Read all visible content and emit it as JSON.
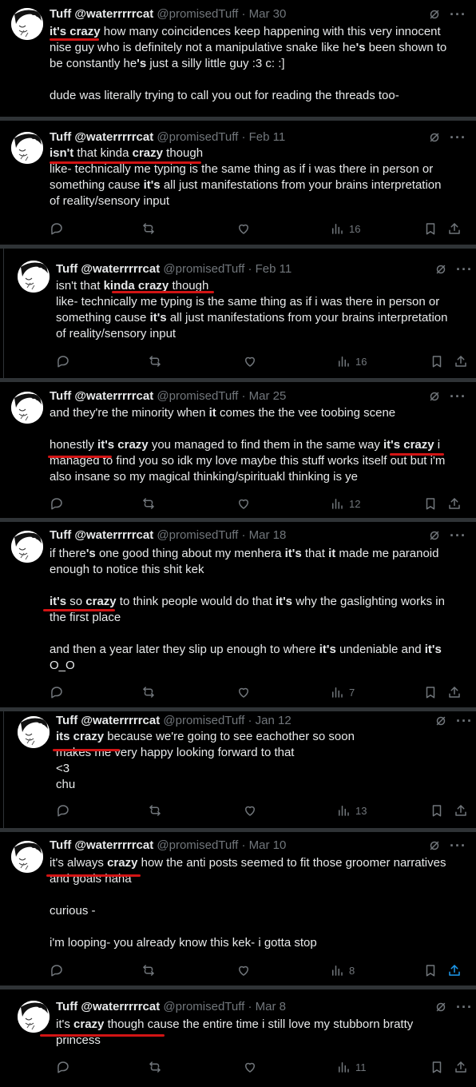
{
  "author": {
    "name": "Tuff",
    "handle_combo": "@waterrrrrcat",
    "at": "@promisedTuff"
  },
  "tweets": [
    {
      "date": "Mar 30",
      "lines": [
        [
          {
            "b": "it's crazy"
          },
          {
            "t": " how many coincidences keep happening with this very innocent"
          }
        ],
        [
          {
            "t": "nise guy who is definitely not a manipulative snake like he"
          },
          {
            "b": "'s"
          },
          {
            "t": " been shown to"
          }
        ],
        [
          {
            "t": "be constantly he"
          },
          {
            "b": "'s"
          },
          {
            "t": " just a silly little guy :3 c: :]"
          }
        ],
        [
          {
            "t": ""
          }
        ],
        [
          {
            "t": "dude was literally trying to call you out for reading the threads too-"
          }
        ]
      ],
      "views": ""
    },
    {
      "date": "Feb 11",
      "lines": [
        [
          {
            "b": "isn't"
          },
          {
            "t": " that kinda "
          },
          {
            "b": "crazy"
          },
          {
            "t": " though"
          }
        ],
        [
          {
            "t": "like- technically me typing is the same thing as if i was there in person or"
          }
        ],
        [
          {
            "t": "something cause "
          },
          {
            "b": "it's"
          },
          {
            "t": " all just manifestations from your brains interpretation"
          }
        ],
        [
          {
            "t": "of reality/sensory input"
          }
        ]
      ],
      "views": "16"
    },
    {
      "date": "Feb 11",
      "lines": [
        [
          {
            "t": "isn't that "
          },
          {
            "b": "kinda crazy"
          },
          {
            "t": " though"
          }
        ],
        [
          {
            "t": "like- technically me typing is the same thing as if i was there in person or"
          }
        ],
        [
          {
            "t": "something cause "
          },
          {
            "b": "it's"
          },
          {
            "t": " all just manifestations from your brains interpretation"
          }
        ],
        [
          {
            "t": "of reality/sensory input"
          }
        ]
      ],
      "views": "16"
    },
    {
      "date": "Mar 25",
      "lines": [
        [
          {
            "t": "and they're the minority when "
          },
          {
            "b": "it"
          },
          {
            "t": " comes the the vee toobing scene"
          }
        ],
        [
          {
            "t": ""
          }
        ],
        [
          {
            "t": "honestly "
          },
          {
            "b": "it's crazy"
          },
          {
            "t": " you managed to find them in the same way "
          },
          {
            "b": "it's crazy"
          },
          {
            "t": " i"
          }
        ],
        [
          {
            "t": "managed to find you so idk my love maybe this stuff works itself out but i'm"
          }
        ],
        [
          {
            "t": "also insane so my magical thinking/spirituakl thinking is ye"
          }
        ]
      ],
      "views": "12"
    },
    {
      "date": "Mar 18",
      "lines": [
        [
          {
            "t": "if there"
          },
          {
            "b": "'s"
          },
          {
            "t": " one good thing about my menhera "
          },
          {
            "b": "it's"
          },
          {
            "t": " that "
          },
          {
            "b": "it"
          },
          {
            "t": " made me paranoid"
          }
        ],
        [
          {
            "t": "enough to notice this shit kek"
          }
        ],
        [
          {
            "t": ""
          }
        ],
        [
          {
            "b": "it's"
          },
          {
            "t": " so "
          },
          {
            "b": "crazy"
          },
          {
            "t": " to think people would do that "
          },
          {
            "b": "it's"
          },
          {
            "t": " why the gaslighting works in"
          }
        ],
        [
          {
            "t": "the first place"
          }
        ],
        [
          {
            "t": ""
          }
        ],
        [
          {
            "t": "and then a year later they slip up enough to where "
          },
          {
            "b": "it's"
          },
          {
            "t": " undeniable and "
          },
          {
            "b": "it's"
          }
        ],
        [
          {
            "t": "O_O"
          }
        ]
      ],
      "views": "7"
    },
    {
      "date": "Jan 12",
      "lines": [
        [
          {
            "b": "its crazy"
          },
          {
            "t": " because we're going to see eachother so soon"
          }
        ],
        [
          {
            "t": "makes me very happy looking forward to that"
          }
        ],
        [
          {
            "t": "<3"
          }
        ],
        [
          {
            "t": "chu"
          }
        ]
      ],
      "views": "13"
    },
    {
      "date": "Mar 10",
      "lines": [
        [
          {
            "t": "it's always "
          },
          {
            "b": "crazy"
          },
          {
            "t": " how the anti posts seemed to fit those groomer narratives"
          }
        ],
        [
          {
            "t": "and goals haha"
          }
        ],
        [
          {
            "t": ""
          }
        ],
        [
          {
            "t": "curious -"
          }
        ],
        [
          {
            "t": ""
          }
        ],
        [
          {
            "t": "i'm looping- you already know this kek- i gotta stop"
          }
        ]
      ],
      "views": "8"
    },
    {
      "date": "Mar 8",
      "lines": [
        [
          {
            "t": "it's "
          },
          {
            "b": "crazy"
          },
          {
            "t": " though cause the entire time i still love my stubborn bratty"
          }
        ],
        [
          {
            "t": "princess"
          }
        ]
      ],
      "views": "11"
    }
  ],
  "colors": {
    "bg": "#000000",
    "text": "#e7e9ea",
    "muted": "#71767b",
    "divider": "#2f3336",
    "underline": "#d21414",
    "share_active": "#1d9bf0"
  }
}
